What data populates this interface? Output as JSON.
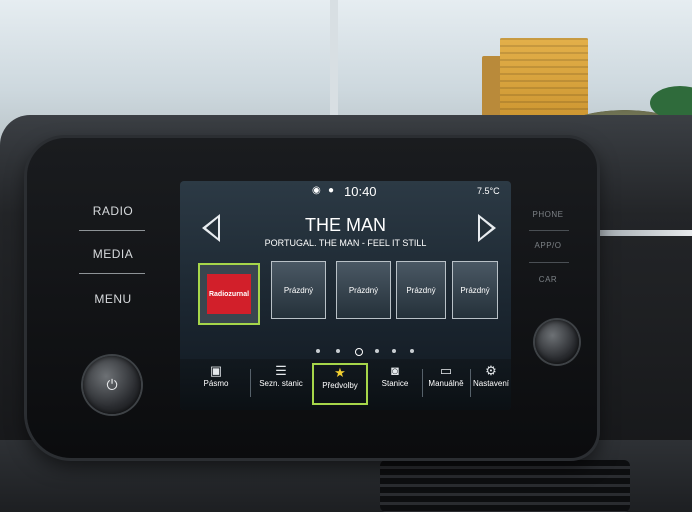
{
  "hardware_buttons_left": {
    "radio": "RADIO",
    "media": "MEDIA",
    "menu": "MENU"
  },
  "hardware_buttons_right": {
    "phone": "PHONE",
    "apps": "APP/O",
    "car": "CAR"
  },
  "status_bar": {
    "time": "10:40",
    "temperature": "7.5°C",
    "icons": [
      "location-icon",
      "user-icon"
    ]
  },
  "now_playing": {
    "title": "THE MAN",
    "subtitle": "PORTUGAL. THE MAN - FEEL IT STILL"
  },
  "presets": [
    {
      "label": "Radiozurnal",
      "active": true,
      "logo_color": "#d21f2a"
    },
    {
      "label": "Prázdný",
      "active": false
    },
    {
      "label": "Prázdný",
      "active": false
    },
    {
      "label": "Prázdný",
      "active": false
    },
    {
      "label": "Prázdný",
      "active": false
    }
  ],
  "page_indicator": {
    "count": 6,
    "current": 3
  },
  "nav": [
    {
      "label": "Pásmo",
      "icon": "radio-icon",
      "active": false
    },
    {
      "label": "Sezn. stanic",
      "icon": "list-icon",
      "active": false
    },
    {
      "label": "Předvolby",
      "icon": "star-icon",
      "active": true
    },
    {
      "label": "Stanice",
      "icon": "station-icon",
      "active": false
    },
    {
      "label": "Manuálně",
      "icon": "tuner-icon",
      "active": false
    },
    {
      "label": "Nastavení",
      "icon": "gear-icon",
      "active": false
    }
  ],
  "colors": {
    "accent": "#a6d64a",
    "star": "#f2cf31",
    "preset_logo": "#d21f2a"
  }
}
